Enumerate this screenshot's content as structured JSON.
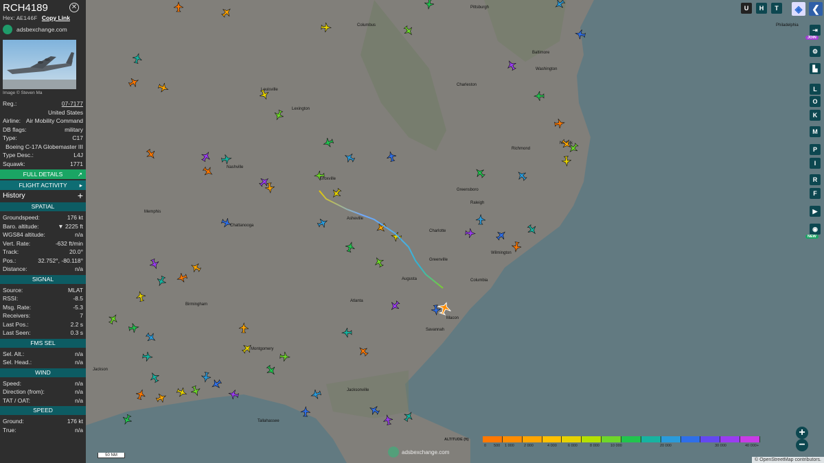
{
  "aircraft": {
    "callsign": "RCH4189",
    "hex_label": "Hex:",
    "hex": "AE146F",
    "copy_link": "Copy Link",
    "site": "adsbexchange.com",
    "photo_credit": "Image © Steven Ma"
  },
  "details": [
    {
      "key": "reg",
      "label": "Reg.:",
      "value": "07-7177",
      "link": true
    },
    {
      "key": "country",
      "label": "",
      "value": "United States"
    },
    {
      "key": "airline",
      "label": "Airline:",
      "value": "Air Mobility Command"
    },
    {
      "key": "db_flags",
      "label": "DB flags:",
      "value": "military"
    },
    {
      "key": "type",
      "label": "Type:",
      "value": "C17"
    },
    {
      "key": "type_name",
      "label": "",
      "value": "Boeing C-17A Globemaster III"
    },
    {
      "key": "type_desc",
      "label": "Type Desc.:",
      "value": "L4J"
    },
    {
      "key": "squawk",
      "label": "Squawk:",
      "value": "1771"
    }
  ],
  "buttons": {
    "full_details": "FULL DETAILS",
    "flight_activity": "FLIGHT ACTIVITY"
  },
  "history_label": "History",
  "sections": {
    "spatial": {
      "title": "SPATIAL",
      "rows": [
        {
          "label": "Groundspeed:",
          "value": "176 kt"
        },
        {
          "label": "Baro. altitude:",
          "value": "▼ 2225 ft"
        },
        {
          "label": "WGS84 altitude:",
          "value": "n/a"
        },
        {
          "label": "Vert. Rate:",
          "value": "-632 ft/min"
        },
        {
          "label": "Track:",
          "value": "20.0°"
        },
        {
          "label": "Pos.:",
          "value": "32.752°, -80.118°"
        },
        {
          "label": "Distance:",
          "value": "n/a"
        }
      ]
    },
    "signal": {
      "title": "SIGNAL",
      "rows": [
        {
          "label": "Source:",
          "value": "MLAT"
        },
        {
          "label": "RSSI:",
          "value": "-8.5"
        },
        {
          "label": "Msg. Rate:",
          "value": "-5.3"
        },
        {
          "label": "Receivers:",
          "value": "7"
        },
        {
          "label": "Last Pos.:",
          "value": "2.2 s"
        },
        {
          "label": "Last Seen:",
          "value": "0.3 s"
        }
      ]
    },
    "fms": {
      "title": "FMS SEL",
      "rows": [
        {
          "label": "Sel. Alt.:",
          "value": "n/a"
        },
        {
          "label": "Sel. Head.:",
          "value": "n/a"
        }
      ]
    },
    "wind": {
      "title": "WIND",
      "rows": [
        {
          "label": "Speed:",
          "value": "n/a"
        },
        {
          "label": "Direction (from):",
          "value": "n/a"
        },
        {
          "label": "TAT / OAT:",
          "value": "n/a"
        }
      ]
    },
    "speed": {
      "title": "SPEED",
      "rows": [
        {
          "label": "Ground:",
          "value": "176 kt"
        },
        {
          "label": "True:",
          "value": "n/a"
        }
      ]
    }
  },
  "map": {
    "top_buttons": [
      "U",
      "H",
      "T"
    ],
    "side_buttons": [
      "L",
      "O",
      "K",
      "M",
      "P",
      "I",
      "R",
      "F"
    ],
    "join_badge": "JOIN",
    "new_badge": "NEW",
    "scale": "50 NM",
    "attribution": "© OpenStreetMap contributors.",
    "watermark": "adsbexchange.com",
    "zoom_in": "+",
    "zoom_out": "−",
    "legend_title": "ALTITUDE (ft)",
    "legend_ticks": [
      "0",
      "500",
      "1 000",
      "2 000",
      "4 000",
      "6 000",
      "8 000",
      "10 000",
      "20 000",
      "30 000",
      "40 000+"
    ],
    "legend_colors": [
      "#ff7800",
      "#ff8c00",
      "#ffa500",
      "#ffc000",
      "#e6d200",
      "#b4e000",
      "#6ed62a",
      "#21c44e",
      "#17b3a0",
      "#2a9bdb",
      "#2f6fe8",
      "#6448f0",
      "#9a3cf0",
      "#c83ce6"
    ],
    "cities": [
      "Columbus",
      "Pittsburgh",
      "Philadelphia",
      "Baltimore",
      "Washington",
      "Richmond",
      "Louisville",
      "Lexington",
      "Charleston",
      "Nashville",
      "Knoxville",
      "Asheville",
      "Charlotte",
      "Raleigh",
      "Greensboro",
      "Memphis",
      "Birmingham",
      "Atlanta",
      "Columbia",
      "Augusta",
      "Savannah",
      "Montgomery",
      "Tallahassee",
      "Jacksonville",
      "Norfolk",
      "Wilmington",
      "Chattanooga",
      "Macon",
      "Jackson",
      "Greenville"
    ]
  }
}
